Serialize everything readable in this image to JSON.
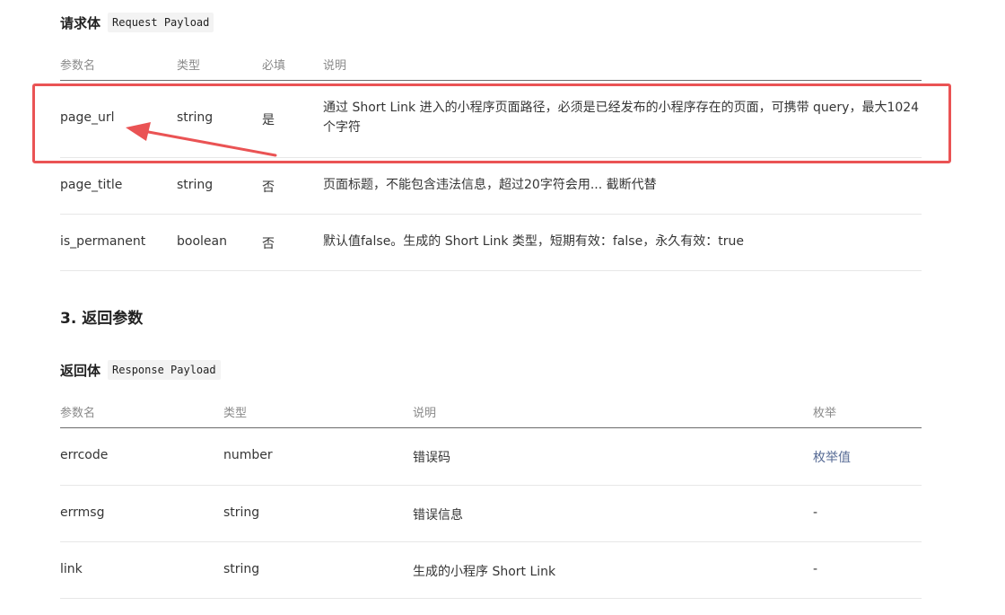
{
  "request": {
    "heading": "请求体",
    "code": "Request Payload",
    "columns": [
      "参数名",
      "类型",
      "必填",
      "说明"
    ],
    "rows": [
      {
        "name": "page_url",
        "type": "string",
        "required": "是",
        "desc_line1": "通过 Short Link 进入的小程序页面路径，必须是已经发布的小程序存在的页面，可携带 query，最大1024",
        "desc_line2": "个字符"
      },
      {
        "name": "page_title",
        "type": "string",
        "required": "否",
        "desc_line1": "页面标题，不能包含违法信息，超过20字符会用... 截断代替",
        "desc_line2": ""
      },
      {
        "name": "is_permanent",
        "type": "boolean",
        "required": "否",
        "desc_line1": "默认值false。生成的 Short Link 类型，短期有效：false，永久有效：true",
        "desc_line2": ""
      }
    ]
  },
  "section3": {
    "title": "3. 返回参数"
  },
  "response": {
    "heading": "返回体",
    "code": "Response Payload",
    "columns": [
      "参数名",
      "类型",
      "说明",
      "枚举"
    ],
    "rows": [
      {
        "name": "errcode",
        "type": "number",
        "desc": "错误码",
        "enum": "枚举值"
      },
      {
        "name": "errmsg",
        "type": "string",
        "desc": "错误信息",
        "enum": "-"
      },
      {
        "name": "link",
        "type": "string",
        "desc": "生成的小程序 Short Link",
        "enum": "-"
      }
    ]
  },
  "colors": {
    "annotation": "#ea5354",
    "link": "#576b95"
  }
}
